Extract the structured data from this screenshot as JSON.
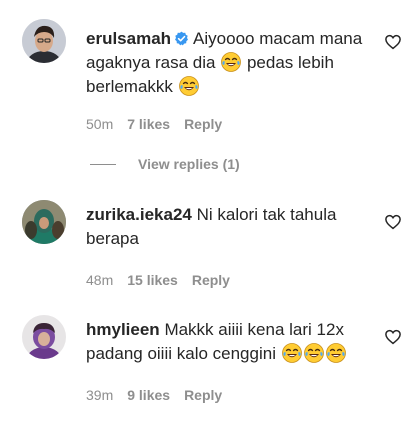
{
  "comments": [
    {
      "username": "erulsamah",
      "verified": true,
      "text_line1": "Aiyoooo macam mana",
      "text_line2a": "agaknya rasa dia",
      "text_line2b": "pedas lebih",
      "text_line3": "berlemakkk",
      "time": "50m",
      "likes": "7 likes",
      "reply": "Reply",
      "emoji": "face-with-tears-of-joy"
    },
    {
      "username": "zurika.ieka24",
      "verified": false,
      "text_line1": "Ni kalori tak tahula",
      "text_line2": "berapa",
      "time": "48m",
      "likes": "15 likes",
      "reply": "Reply"
    },
    {
      "username": "hmylieen",
      "verified": false,
      "text_line1": "Makkk aiiii kena lari 12x",
      "text_line2": "padang oiiii kalo cenggini",
      "time": "39m",
      "likes": "9 likes",
      "reply": "Reply",
      "emoji": "face-with-tears-of-joy"
    }
  ],
  "view_replies": "View replies (1)",
  "colors": {
    "text": "#262626",
    "meta": "#8e8e8e",
    "verified": "#3897f0",
    "emoji_face": "#ffcc33"
  }
}
